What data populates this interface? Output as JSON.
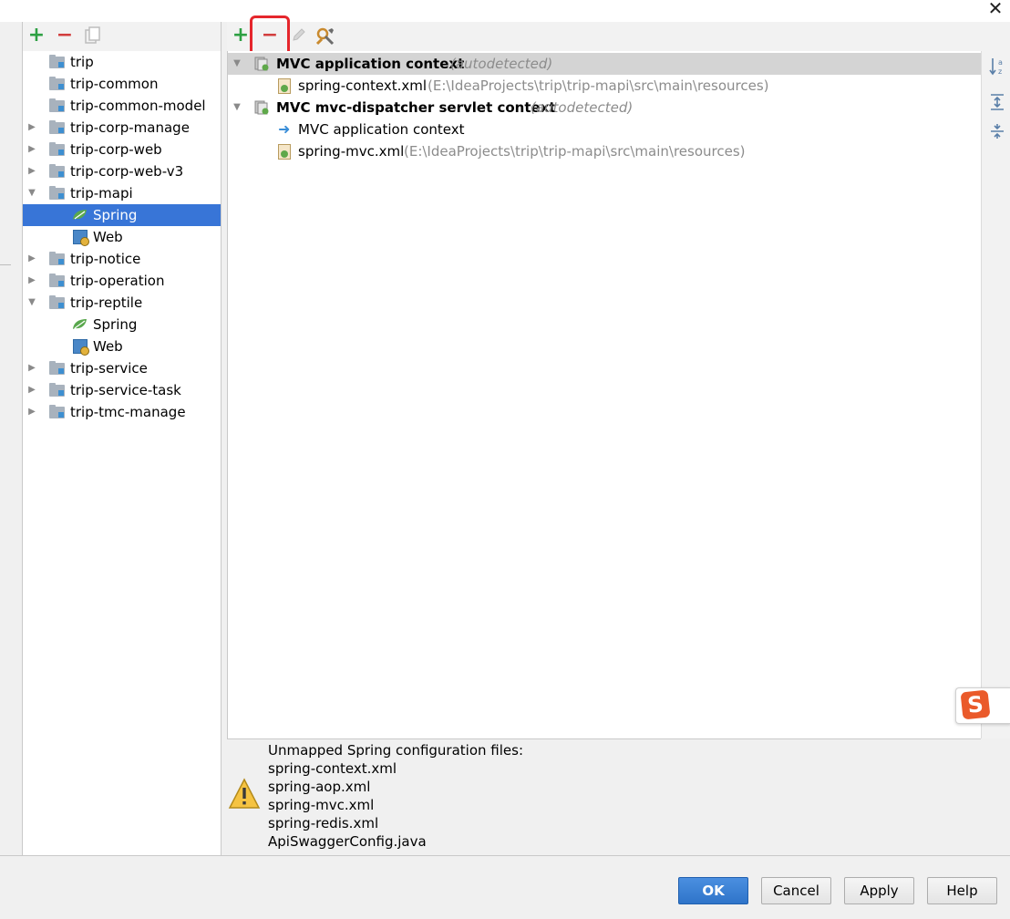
{
  "window": {
    "close_glyph": "✕"
  },
  "module_toolbar": {
    "add_glyph": "+",
    "remove_glyph": "−",
    "copy_icon": "copy-icon"
  },
  "modules": [
    {
      "label": "trip",
      "expanded": null
    },
    {
      "label": "trip-common",
      "expanded": null
    },
    {
      "label": "trip-common-model",
      "expanded": null
    },
    {
      "label": "trip-corp-manage",
      "expanded": false
    },
    {
      "label": "trip-corp-web",
      "expanded": false
    },
    {
      "label": "trip-corp-web-v3",
      "expanded": false
    },
    {
      "label": "trip-mapi",
      "expanded": true
    },
    {
      "label": "Spring",
      "facet": "spring",
      "selected": true
    },
    {
      "label": "Web",
      "facet": "web"
    },
    {
      "label": "trip-notice",
      "expanded": false
    },
    {
      "label": "trip-operation",
      "expanded": false
    },
    {
      "label": "trip-reptile",
      "expanded": true
    },
    {
      "label": "Spring",
      "facet": "spring"
    },
    {
      "label": "Web",
      "facet": "web"
    },
    {
      "label": "trip-service",
      "expanded": false
    },
    {
      "label": "trip-service-task",
      "expanded": false
    },
    {
      "label": "trip-tmc-manage",
      "expanded": false
    }
  ],
  "context_toolbar": {
    "add_glyph": "+",
    "remove_glyph": "−",
    "edit_icon": "pencil-icon",
    "settings_icon": "tools-icon"
  },
  "contexts": {
    "ctx1": {
      "name": "MVC application context",
      "tag": "(autodetected)"
    },
    "ctx1_file": {
      "name": "spring-context.xml",
      "path": "(E:\\IdeaProjects\\trip\\trip-mapi\\src\\main\\resources)"
    },
    "ctx2": {
      "name": "MVC mvc-dispatcher servlet context",
      "tag": "(autodetected)"
    },
    "ctx2_parent": {
      "name": "MVC application context"
    },
    "ctx2_file": {
      "name": "spring-mvc.xml",
      "path": "(E:\\IdeaProjects\\trip\\trip-mapi\\src\\main\\resources)"
    }
  },
  "side_toolbar": {
    "sort_glyph": "↓a z",
    "expand_glyph": "⇕",
    "collapse_glyph": "≡"
  },
  "warning": {
    "title": "Unmapped Spring configuration files:",
    "files": [
      "spring-context.xml",
      "spring-aop.xml",
      "spring-mvc.xml",
      "spring-redis.xml",
      "ApiSwaggerConfig.java"
    ]
  },
  "ime": {
    "letter": "S"
  },
  "buttons": {
    "ok": "OK",
    "cancel": "Cancel",
    "apply": "Apply",
    "help": "Help"
  },
  "colors": {
    "selection": "#3875d7",
    "highlight_box": "#e5262c",
    "ok_button": "#2f74c9"
  }
}
